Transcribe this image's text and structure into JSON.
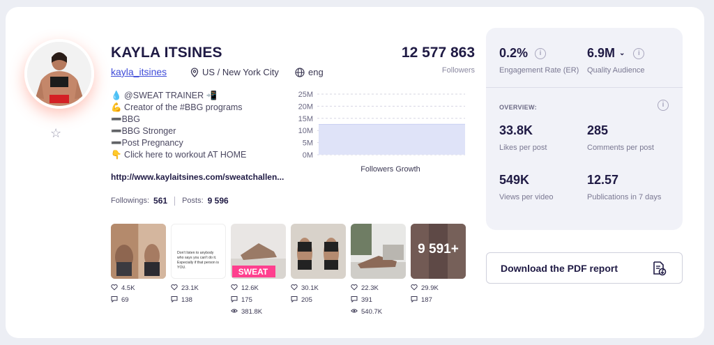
{
  "profile": {
    "name": "KAYLA ITSINES",
    "handle": "kayla_itsines",
    "location": "US / New York City",
    "language": "eng",
    "followers_value": "12 577 863",
    "followers_label": "Followers"
  },
  "bio": [
    "💧 @SWEAT TRAINER 📲",
    "💪 Creator of the #BBG programs",
    "➖BBG",
    "➖BBG Stronger",
    "➖Post Pregnancy",
    "👇 Click here to workout AT HOME"
  ],
  "link": "http://www.kaylaitsines.com/sweatchallen...",
  "counts": {
    "followings_label": "Followings:",
    "followings_value": "561",
    "posts_label": "Posts:",
    "posts_value": "9 596"
  },
  "chart_data": {
    "type": "area",
    "title": "Followers Growth",
    "yticks": [
      "25M",
      "20M",
      "15M",
      "10M",
      "5M",
      "0M"
    ],
    "ylim": [
      0,
      25000000
    ],
    "series": [
      {
        "values": [
          12500000,
          12520000,
          12540000,
          12560000,
          12577863
        ]
      }
    ],
    "grid": true
  },
  "posts": [
    {
      "likes": "4.5K",
      "comments": "69",
      "views": null,
      "image": "before-after-photo"
    },
    {
      "likes": "23.1K",
      "comments": "138",
      "views": null,
      "image": "text-quote",
      "quote": "Don't listen to anybody who says you can't do it. Especially if that person is YOU."
    },
    {
      "likes": "12.6K",
      "comments": "175",
      "views": "381.8K",
      "image": "sweat-challenge"
    },
    {
      "likes": "30.1K",
      "comments": "205",
      "views": null,
      "image": "before-after-photo"
    },
    {
      "likes": "22.3K",
      "comments": "391",
      "views": "540.7K",
      "image": "workout-video"
    },
    {
      "likes": "29.9K",
      "comments": "187",
      "views": null,
      "image": "more-posts",
      "overlay": "9 591+"
    }
  ],
  "metrics": {
    "er_value": "0.2%",
    "er_label": "Engagement Rate (ER)",
    "qa_value": "6.9M",
    "qa_label": "Quality Audience",
    "overview_label": "OVERVIEW:",
    "likes_value": "33.8K",
    "likes_label": "Likes per post",
    "comments_value": "285",
    "comments_label": "Comments per post",
    "views_value": "549K",
    "views_label": "Views per video",
    "pubs_value": "12.57",
    "pubs_label": "Publications in 7 days"
  },
  "pdf_button": "Download the PDF report",
  "colors": {
    "accent": "#3e4bd8",
    "dark": "#1f1a44",
    "panel": "#f1f2f8"
  }
}
